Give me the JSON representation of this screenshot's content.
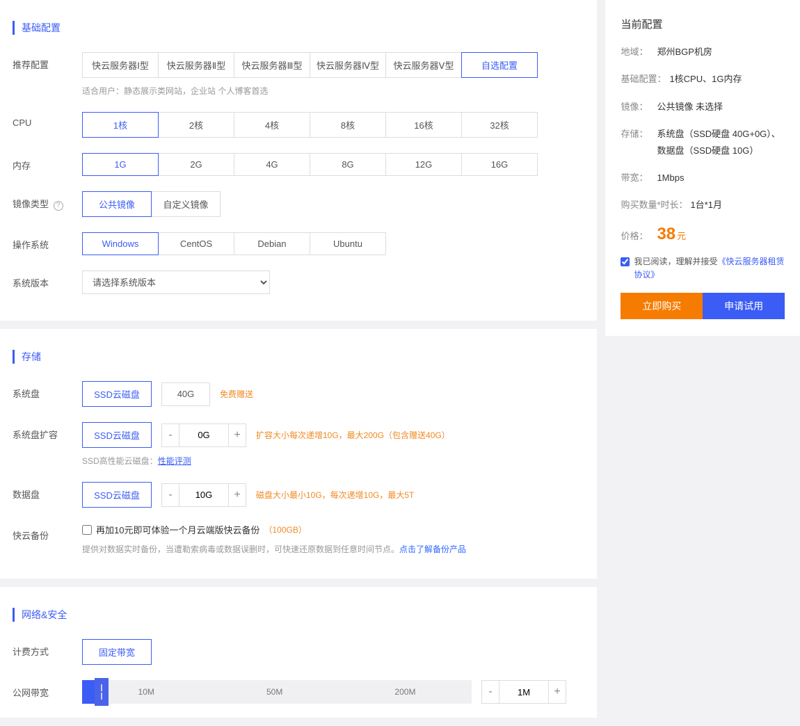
{
  "sections": {
    "basic": "基础配置",
    "storage": "存储",
    "network": "网络&安全"
  },
  "labels": {
    "recommend": "推荐配置",
    "cpu": "CPU",
    "memory": "内存",
    "imgtype": "镜像类型",
    "os": "操作系统",
    "sysver": "系统版本",
    "sysdisk": "系统盘",
    "sysdisk_ext": "系统盘扩容",
    "datadisk": "数据盘",
    "backup": "快云备份",
    "billing": "计费方式",
    "bandwidth": "公网带宽"
  },
  "recommend": {
    "opts": [
      "快云服务器Ⅰ型",
      "快云服务器Ⅱ型",
      "快云服务器Ⅲ型",
      "快云服务器Ⅳ型",
      "快云服务器Ⅴ型",
      "自选配置"
    ],
    "selected": 5,
    "hint": "适合用户：静态展示类网站，企业站 个人博客首选"
  },
  "cpu": {
    "opts": [
      "1核",
      "2核",
      "4核",
      "8核",
      "16核",
      "32核"
    ],
    "selected": 0
  },
  "memory": {
    "opts": [
      "1G",
      "2G",
      "4G",
      "8G",
      "12G",
      "16G"
    ],
    "selected": 0
  },
  "imgtype": {
    "opts": [
      "公共镜像",
      "自定义镜像"
    ],
    "selected": 0
  },
  "os": {
    "opts": [
      "Windows",
      "CentOS",
      "Debian",
      "Ubuntu"
    ],
    "selected": 0
  },
  "sysver": {
    "placeholder": "请选择系统版本"
  },
  "sysdisk": {
    "type": "SSD云磁盘",
    "size": "40G",
    "note": "免费赠送"
  },
  "sysdisk_ext": {
    "type": "SSD云磁盘",
    "size": "0G",
    "note": "扩容大小每次递增10G，最大200G（包含赠送40G）",
    "perf_label": "SSD高性能云磁盘：",
    "perf_link": "性能评测"
  },
  "datadisk": {
    "type": "SSD云磁盘",
    "size": "10G",
    "note": "磁盘大小最小10G，每次递增10G，最大5T"
  },
  "backup": {
    "chk_label": "再加10元即可体验一个月云端版快云备份",
    "chk_extra": "（100GB）",
    "desc": "提供对数据实时备份，当遭勒索病毒或数据误删时，可快速还原数据到任意时间节点。",
    "link": "点击了解备份产品"
  },
  "billing": {
    "opts": [
      "固定带宽"
    ],
    "selected": 0
  },
  "bandwidth": {
    "ticks": [
      "10M",
      "50M",
      "200M"
    ],
    "value": "1M"
  },
  "side": {
    "title": "当前配置",
    "region_k": "地域：",
    "region_v": "郑州BGP机房",
    "basic_k": "基础配置：",
    "basic_v": "1核CPU、1G内存",
    "image_k": "镜像：",
    "image_v": "公共镜像 未选择",
    "storage_k": "存储：",
    "storage_v": "系统盘（SSD硬盘 40G+0G）、 数据盘（SSD硬盘 10G）",
    "bw_k": "带宽：",
    "bw_v": "1Mbps",
    "qty_k": "购买数量*时长：",
    "qty_v": "1台*1月",
    "price_k": "价格：",
    "price_num": "38",
    "price_unit": "元",
    "agree_text": "我已阅读，理解并接受",
    "agree_link": "《快云服务器租赁协议》",
    "buy": "立即购买",
    "trial": "申请试用"
  }
}
